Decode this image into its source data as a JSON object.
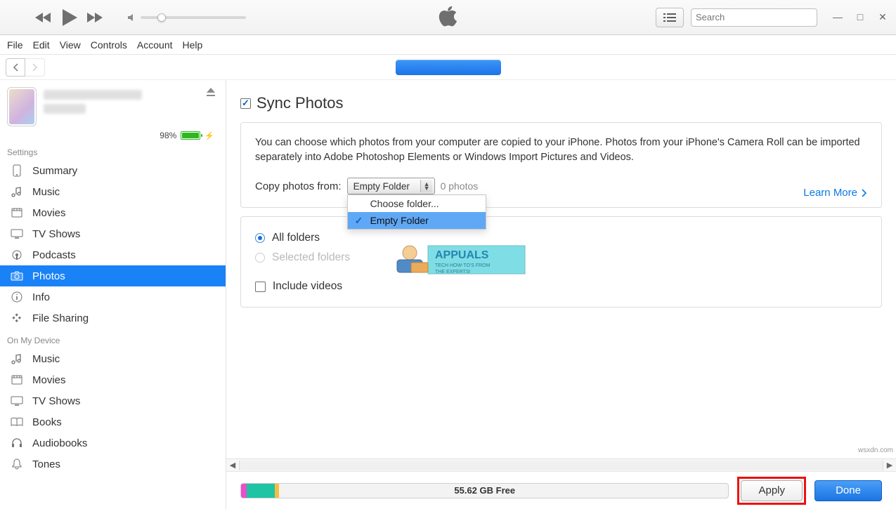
{
  "titlebar": {
    "search_placeholder": "Search"
  },
  "menubar": {
    "file": "File",
    "edit": "Edit",
    "view": "View",
    "controls": "Controls",
    "account": "Account",
    "help": "Help"
  },
  "device": {
    "battery_percent": "98%"
  },
  "sidebar": {
    "settings_label": "Settings",
    "on_device_label": "On My Device",
    "settings": {
      "summary": "Summary",
      "music": "Music",
      "movies": "Movies",
      "tvshows": "TV Shows",
      "podcasts": "Podcasts",
      "photos": "Photos",
      "info": "Info",
      "filesharing": "File Sharing"
    },
    "device": {
      "music": "Music",
      "movies": "Movies",
      "tvshows": "TV Shows",
      "books": "Books",
      "audiobooks": "Audiobooks",
      "tones": "Tones"
    }
  },
  "content": {
    "sync_title": "Sync Photos",
    "info_text": "You can choose which photos from your computer are copied to your iPhone. Photos from your iPhone's Camera Roll can be imported separately into Adobe Photoshop Elements or Windows Import Pictures and Videos.",
    "copy_label": "Copy photos from:",
    "dropdown_selected": "Empty Folder",
    "dropdown_options": {
      "choose": "Choose folder...",
      "empty": "Empty Folder"
    },
    "photo_count": "0 photos",
    "learn_more": "Learn More",
    "radio_all": "All folders",
    "radio_selected": "Selected folders",
    "include_videos": "Include videos"
  },
  "footer": {
    "free_space": "55.62 GB Free",
    "apply": "Apply",
    "done": "Done"
  },
  "watermark": {
    "brand": "APPUALS",
    "tag1": "TECH HOW-TO'S FROM",
    "tag2": "THE EXPERTS!"
  },
  "credit": "wsxdn.com"
}
